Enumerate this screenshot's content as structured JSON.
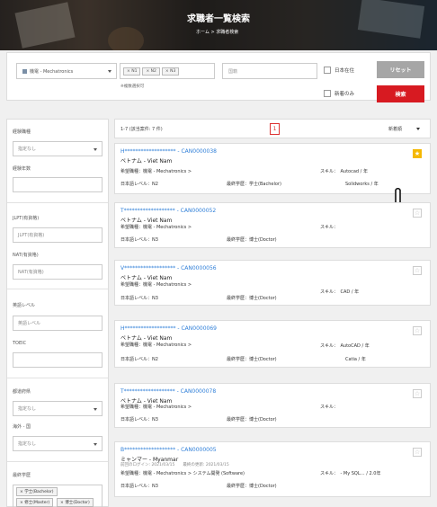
{
  "hero": {
    "title": "求職者一覧検索",
    "breadcrumb": "ホーム > 求職者検索"
  },
  "search": {
    "category_value": "機電 - Mechatronics",
    "level_chips": [
      "× N1",
      "× N2",
      "× N3"
    ],
    "level_note": "※複数選択可",
    "country_placeholder": "国籍",
    "japan_resident_label": "日本在住",
    "new_only_label": "新着のみ",
    "reset_label": "リセット",
    "search_label": "検索",
    "colors": {
      "reset": "#a6a6a6",
      "search": "#d71a21"
    }
  },
  "sidebar": {
    "job_type_label": "経験職種",
    "job_type_value": "指定なし",
    "years_label": "経験年数",
    "jlpt_label": "JLPT(有資格)",
    "jlpt_placeholder": "JLPT(有資格)",
    "nat_label": "NAT(有資格)",
    "nat_placeholder": "NAT(有資格)",
    "english_label": "英語レベル",
    "english_placeholder": "英語レベル",
    "toeic_label": "TOEIC",
    "pref_label": "都道府県",
    "pref_value": "指定なし",
    "overseas_label": "海外 - 国",
    "overseas_value": "指定なし",
    "education_label": "最終学歴",
    "education_chips": [
      "× 学士(Bachelor)",
      "× 修士(Master)",
      "× 博士(Doctor)"
    ]
  },
  "results": {
    "count_text": "1-7 (該当案件: 7 件)",
    "page": "1",
    "sort_label": "新着順",
    "hope_label": "希望職種：機電 - Mechatronics >",
    "jp_label_prefix": "日本語レベル：",
    "edu_label_prefix": "最終学歴：",
    "skill_label": "スキル：",
    "cards": [
      {
        "name": "H******************* - CAN0000038",
        "country": "ベトナム - Viet Nam",
        "hope": "希望職種：機電 - Mechatronics >",
        "jp": "日本語レベル：N2",
        "edu": "最終学歴：学士(Bachelor)",
        "skill": "スキル：　Autocad / 年",
        "skill2": "Solidworks / 年",
        "starred": true
      },
      {
        "name": "T******************* - CAN0000052",
        "country": "ベトナム - Viet Nam",
        "hope": "希望職種：機電 - Mechatronics >",
        "jp": "日本語レベル：N3",
        "edu": "最終学歴：博士(Doctor)",
        "skill": "スキル：",
        "skill2": "",
        "starred": false
      },
      {
        "name": "V******************* - CAN0000056",
        "country": "ベトナム - Viet Nam",
        "hope": "希望職種：機電 - Mechatronics >",
        "jp": "日本語レベル：N3",
        "edu": "最終学歴：博士(Doctor)",
        "skill": "スキル：　CAD / 年",
        "skill2": "",
        "starred": false
      },
      {
        "name": "H******************* - CAN0000069",
        "country": "ベトナム - Viet Nam",
        "hope": "希望職種：機電 - Mechatronics >",
        "jp": "日本語レベル：N2",
        "edu": "最終学歴：博士(Doctor)",
        "skill": "スキル：　AutoCAD / 年",
        "skill2": "Catia / 年",
        "starred": false
      },
      {
        "name": "T******************* - CAN0000078",
        "country": "ベトナム - Viet Nam",
        "hope": "希望職種：機電 - Mechatronics >",
        "jp": "日本語レベル：N3",
        "edu": "最終学歴：博士(Doctor)",
        "skill": "スキル：",
        "skill2": "",
        "starred": false
      },
      {
        "name": "B******************* - CAN0000005",
        "country": "ミャンマー - Myanmar",
        "meta": "前回のログイン: 2021/03/15　　最終の更新: 2021/03/15",
        "hope": "希望職種：機電 - Mechatronics > システム開発 (Software)",
        "jp": "日本語レベル：N3",
        "edu": "最終学歴：博士(Doctor)",
        "skill": "スキル：　- My SQL… / 2.0年",
        "skill2": "",
        "starred": false
      }
    ]
  },
  "icons": {
    "star": "star-icon",
    "hand_cursor": "hand-pointer-icon"
  },
  "colors": {
    "accent_link": "#2f7fd8",
    "star_on": "#f5b800",
    "pagination": "#dd3333"
  }
}
